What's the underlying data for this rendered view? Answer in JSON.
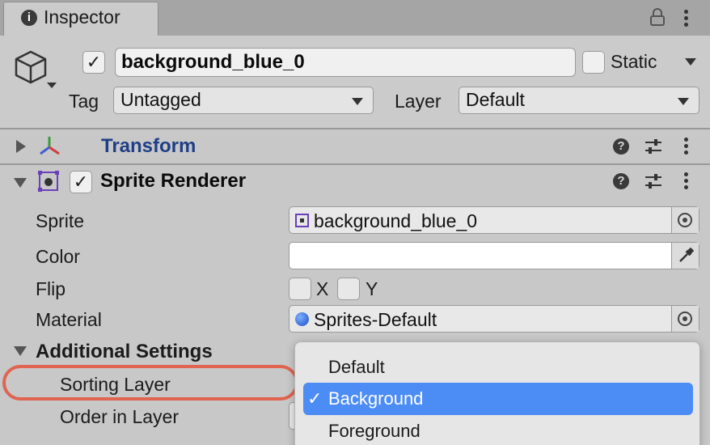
{
  "tab": {
    "label": "Inspector",
    "icon": "info-icon"
  },
  "header": {
    "active_checked": true,
    "object_name": "background_blue_0",
    "static_label": "Static",
    "tag_label": "Tag",
    "tag_value": "Untagged",
    "layer_label": "Layer",
    "layer_value": "Default"
  },
  "components": {
    "transform": {
      "title": "Transform"
    },
    "sprite_renderer": {
      "title": "Sprite Renderer",
      "enabled": true,
      "fields": {
        "sprite_label": "Sprite",
        "sprite_value": "background_blue_0",
        "color_label": "Color",
        "color_value": "#ffffff",
        "flip_label": "Flip",
        "flip_x": "X",
        "flip_y": "Y",
        "material_label": "Material",
        "material_value": "Sprites-Default"
      },
      "additional": {
        "title": "Additional Settings",
        "sorting_layer_label": "Sorting Layer",
        "order_in_layer_label": "Order in Layer"
      }
    }
  },
  "sorting_layer_popup": {
    "options": [
      "Default",
      "Background",
      "Foreground"
    ],
    "selected": "Background",
    "check_mark": "✓"
  },
  "colors": {
    "selection": "#4c8cf5",
    "annotation": "#e0644f",
    "transform_title": "#1f3f86"
  }
}
